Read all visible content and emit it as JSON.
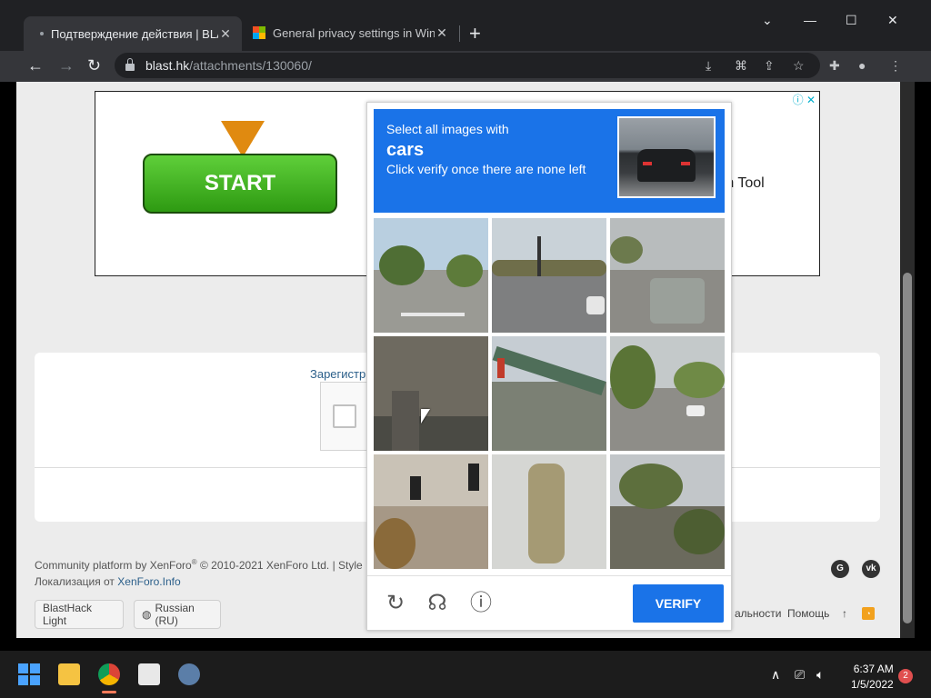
{
  "browser": {
    "tabs": [
      {
        "title": "Подтверждение действия | BLA",
        "active": true
      },
      {
        "title": "General privacy settings in Windo",
        "active": false
      }
    ],
    "new_tab": "+",
    "url_host": "blast.hk",
    "url_path": "/attachments/130060/"
  },
  "page": {
    "ad": {
      "button_label": "START",
      "text": "rch Tool",
      "icons": "ⓘ ✕"
    },
    "register_link": "Зарегистри",
    "footer": {
      "line1": "Community platform by XenForo",
      "reg_mark": "®",
      "line1_rest": " © 2010-2021 XenForo Ltd. | Style",
      "line2": "Локализация от ",
      "line2_link": "XenForo.Info",
      "theme_label": "BlastHack Light",
      "lang_label": "Russian (RU)",
      "right_link1": "альности",
      "right_link2": "Помощь",
      "up": "↑"
    }
  },
  "captcha": {
    "prompt_line1": "Select all images with",
    "prompt_target": "cars",
    "prompt_line3": "Click verify once there are none left",
    "verify_label": "VERIFY",
    "tiles": [
      {
        "label": "street-trees"
      },
      {
        "label": "intersection-traffic-light"
      },
      {
        "label": "car-on-road"
      },
      {
        "label": "bridge-underside"
      },
      {
        "label": "bridge-traffic-light"
      },
      {
        "label": "residential-street-cars"
      },
      {
        "label": "traffic-lights-building"
      },
      {
        "label": "statue"
      },
      {
        "label": "palm-trees"
      }
    ]
  },
  "taskbar": {
    "time": "6:37 AM",
    "date": "1/5/2022",
    "notifications": "2"
  }
}
